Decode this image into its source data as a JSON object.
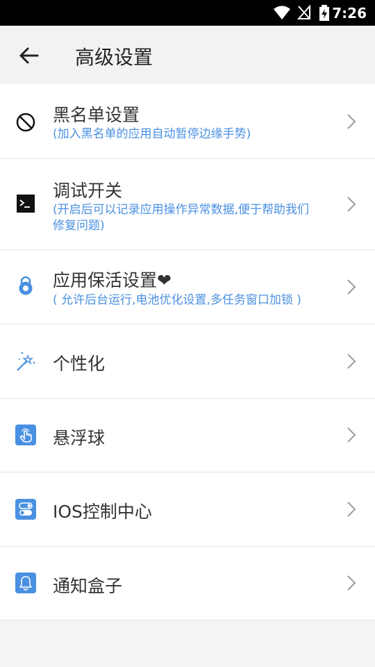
{
  "status_bar": {
    "time": "7:26"
  },
  "app_bar": {
    "title": "高级设置"
  },
  "items": [
    {
      "title": "黑名单设置",
      "subtitle": "(加入黑名单的应用自动暂停边缘手势)",
      "icon": "block-icon"
    },
    {
      "title": "调试开关",
      "subtitle": "(开启后可以记录应用操作异常数据,便于帮助我们修复问题)",
      "icon": "terminal-icon"
    },
    {
      "title": "应用保活设置❤",
      "subtitle": "( 允许后台运行,电池优化设置,多任务窗口加锁 )",
      "icon": "lock-icon"
    },
    {
      "title": "个性化",
      "subtitle": "",
      "icon": "magic-wand-icon"
    },
    {
      "title": "悬浮球",
      "subtitle": "",
      "icon": "touch-icon"
    },
    {
      "title": "IOS控制中心",
      "subtitle": "",
      "icon": "toggle-icon"
    },
    {
      "title": "通知盒子",
      "subtitle": "",
      "icon": "bell-icon"
    }
  ],
  "colors": {
    "accent": "#4a90e2",
    "status_bar": "#000000",
    "app_bar": "#f2f2f2"
  }
}
